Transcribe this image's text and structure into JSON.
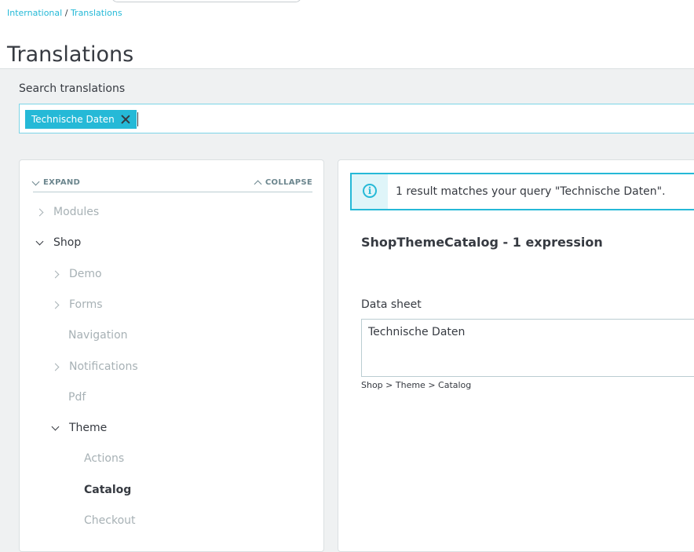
{
  "header": {
    "breadcrumb": {
      "parent": "International",
      "separator": "/",
      "current": "Translations"
    },
    "title": "Translations"
  },
  "search": {
    "label": "Search translations",
    "tags": [
      "Technische Daten"
    ]
  },
  "tree": {
    "expand_label": "EXPAND",
    "collapse_label": "COLLAPSE",
    "items": [
      {
        "label": "Modules",
        "state": "collapsed",
        "level": 0
      },
      {
        "label": "Shop",
        "state": "expanded",
        "level": 0
      },
      {
        "label": "Demo",
        "state": "collapsed",
        "level": 1
      },
      {
        "label": "Forms",
        "state": "collapsed",
        "level": 1
      },
      {
        "label": "Navigation",
        "state": "leaf",
        "level": 1
      },
      {
        "label": "Notifications",
        "state": "collapsed",
        "level": 1
      },
      {
        "label": "Pdf",
        "state": "leaf",
        "level": 1
      },
      {
        "label": "Theme",
        "state": "expanded",
        "level": 1
      },
      {
        "label": "Actions",
        "state": "leaf",
        "level": 2
      },
      {
        "label": "Catalog",
        "state": "selected",
        "level": 2
      },
      {
        "label": "Checkout",
        "state": "leaf",
        "level": 2
      }
    ]
  },
  "results": {
    "alert_text": "1 result matches your query \"Technische Daten\".",
    "domain_title": "ShopThemeCatalog - 1 expression",
    "field_label": "Data sheet",
    "field_value": "Technische Daten",
    "path": "Shop > Theme > Catalog"
  },
  "colors": {
    "accent": "#25b9d7",
    "text": "#363a41",
    "muted": "#a7b1b5"
  }
}
